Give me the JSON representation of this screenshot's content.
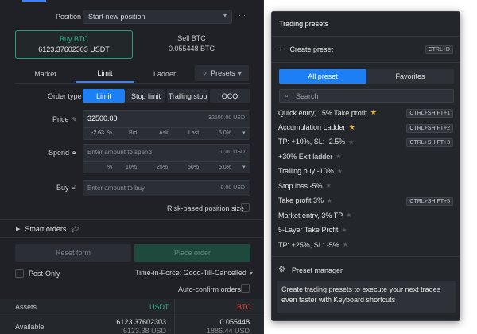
{
  "position": {
    "label": "Position",
    "value": "Start new position",
    "more": "···"
  },
  "trade": {
    "buy": {
      "label": "Buy BTC",
      "amount": "6123.37602303",
      "unit": "USDT"
    },
    "sell": {
      "label": "Sell BTC",
      "amount": "0.055448",
      "unit": "BTC"
    }
  },
  "tabs": {
    "market": "Market",
    "limit": "Limit",
    "ladder": "Ladder",
    "presets": "Presets"
  },
  "order_type": {
    "label": "Order type",
    "limit": "Limit",
    "stop_limit": "Stop limit",
    "trailing_stop": "Trailing stop",
    "oco": "OCO"
  },
  "price": {
    "label": "Price",
    "value": "32500.00",
    "hint": "32500.00 USD",
    "percent": "-2.63",
    "percent_unit": "%",
    "bid": "Bid",
    "ask": "Ask",
    "last": "Last",
    "step": "5.0%"
  },
  "spend": {
    "label": "Spend",
    "placeholder": "Enter amount to spend",
    "hint": "0.00 USD",
    "pct_unit": "%",
    "p10": "10%",
    "p25": "25%",
    "p50": "50%",
    "step": "5.0%"
  },
  "buy_field": {
    "label": "Buy",
    "placeholder": "Enter amount to buy",
    "hint": "0.00 USD"
  },
  "risk_label": "Risk-based position size",
  "smart_orders": "Smart orders",
  "buttons": {
    "reset": "Reset form",
    "place": "Place order"
  },
  "post_only": "Post-Only",
  "tif": "Time-in-Force: Good-Till-Cancelled",
  "auto_confirm": "Auto-confirm orders",
  "assets": {
    "header": "Assets",
    "col_usdt": "USDT",
    "col_btc": "BTC",
    "available_label": "Available",
    "usdt_available": "6123.37602303",
    "usdt_sub": "6123.38 USD",
    "btc_available": "0.055448",
    "btc_sub": "1886.44 USD"
  },
  "presets_popup": {
    "title": "Trading presets",
    "create": {
      "label": "Create preset",
      "shortcut": "CTRL+D"
    },
    "tab_all": "All preset",
    "tab_fav": "Favorites",
    "search_placeholder": "Search",
    "items": [
      {
        "label": "Quick entry, 15% Take profit",
        "fav": true,
        "shortcut": "CTRL+SHIFT+1"
      },
      {
        "label": "Accumulation Ladder",
        "fav": true,
        "shortcut": "CTRL+SHIFT+2"
      },
      {
        "label": "TP: +10%, SL: -2.5%",
        "fav": false,
        "shortcut": "CTRL+SHIFT+3"
      },
      {
        "label": "+30% Exit ladder",
        "fav": false,
        "shortcut": ""
      },
      {
        "label": "Trailing buy -10%",
        "fav": false,
        "shortcut": ""
      },
      {
        "label": "Stop loss -5%",
        "fav": false,
        "shortcut": ""
      },
      {
        "label": "Take profit 3%",
        "fav": false,
        "shortcut": "CTRL+SHIFT+5"
      },
      {
        "label": "Market entry, 3% TP",
        "fav": false,
        "shortcut": ""
      },
      {
        "label": "5-Layer Take Profit",
        "fav": false,
        "shortcut": ""
      },
      {
        "label": "TP: +25%, SL: -5%",
        "fav": false,
        "shortcut": ""
      }
    ],
    "manager": "Preset manager",
    "info": "Create trading presets to execute your next trades even faster with Keyboard shortcuts"
  },
  "colors": {
    "accent": "#1d7ff5",
    "buy_green": "#26a17b",
    "sell_red": "#e2483d",
    "star": "#f5b82e"
  }
}
